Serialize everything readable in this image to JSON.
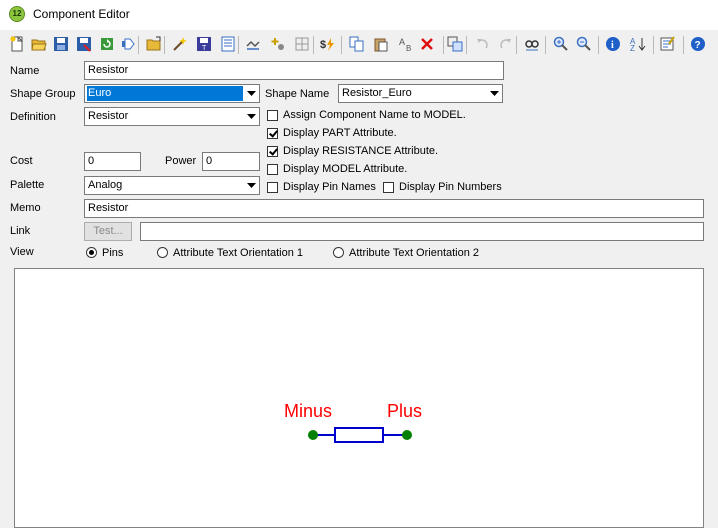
{
  "window": {
    "title": "Component Editor",
    "icon_text": "12"
  },
  "toolbar": {
    "icons": [
      "new-icon",
      "open-icon",
      "save-icon",
      "save-as-icon",
      "refresh-icon",
      "pin-icon",
      "folder-icon",
      "wand-icon",
      "save-alt-icon",
      "list-icon",
      "shape-icon",
      "plus-icon",
      "grid-icon",
      "bolt-icon",
      "copy-icon",
      "paste-icon",
      "text-icon",
      "delete-icon",
      "group-icon",
      "undo-icon",
      "redo-icon",
      "find-icon",
      "zoom-in-icon",
      "zoom-out-icon",
      "info-icon",
      "sort-icon",
      "properties-icon",
      "help-icon"
    ]
  },
  "form": {
    "name_label": "Name",
    "name_value": "Resistor",
    "shape_group_label": "Shape Group",
    "shape_group_value": "Euro",
    "shape_name_label": "Shape Name",
    "shape_name_value": "Resistor_Euro",
    "definition_label": "Definition",
    "definition_value": "Resistor",
    "cost_label": "Cost",
    "cost_value": "0",
    "power_label": "Power",
    "power_value": "0",
    "palette_label": "Palette",
    "palette_value": "Analog",
    "memo_label": "Memo",
    "memo_value": "Resistor",
    "link_label": "Link",
    "link_value": "",
    "test_button": "Test...",
    "view_label": "View"
  },
  "options": {
    "assign_name": {
      "label": "Assign Component Name to MODEL.",
      "checked": false
    },
    "display_part": {
      "label": "Display PART Attribute.",
      "checked": true
    },
    "display_resistance": {
      "label": "Display RESISTANCE Attribute.",
      "checked": true
    },
    "display_model": {
      "label": "Display MODEL Attribute.",
      "checked": false
    },
    "display_pin_names": {
      "label": "Display Pin Names",
      "checked": false
    },
    "display_pin_numbers": {
      "label": "Display Pin Numbers",
      "checked": false
    }
  },
  "view": {
    "pins": {
      "label": "Pins",
      "selected": true
    },
    "orientation1": {
      "label": "Attribute Text Orientation 1",
      "selected": false
    },
    "orientation2": {
      "label": "Attribute Text Orientation 2",
      "selected": false
    }
  },
  "canvas": {
    "pin_minus": "Minus",
    "pin_plus": "Plus",
    "colors": {
      "pin_label": "#ff0000",
      "body": "#0000cc",
      "pin_dot": "#008000"
    }
  }
}
